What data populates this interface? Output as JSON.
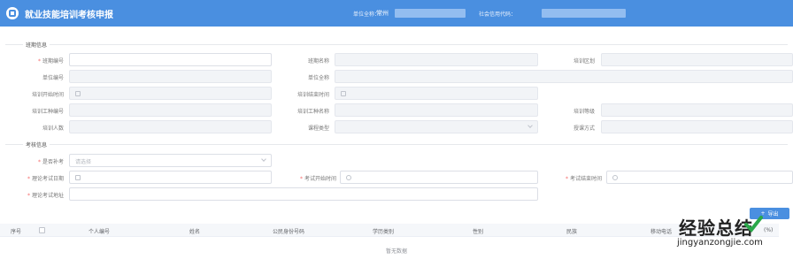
{
  "header": {
    "title": "就业技能培训考核申报",
    "unit_label": "单位全称：",
    "unit_value": "常州",
    "credit_label": "社会信用代码："
  },
  "sections": {
    "class_info": "班期信息",
    "exam_info": "考核信息"
  },
  "class_form": {
    "class_no": {
      "label": "班期编号"
    },
    "class_name": {
      "label": "班期名称"
    },
    "training_district": {
      "label": "培训区划"
    },
    "unit_no": {
      "label": "单位编号"
    },
    "unit_full_name": {
      "label": "单位全称"
    },
    "training_start": {
      "label": "培训开始时间"
    },
    "training_end": {
      "label": "培训结束时间"
    },
    "job_type_no": {
      "label": "培训工种编号"
    },
    "job_type_name": {
      "label": "培训工种名称"
    },
    "training_level": {
      "label": "培训等级"
    },
    "trainee_count": {
      "label": "培训人数"
    },
    "course_type": {
      "label": "课程类型"
    },
    "teaching_mode": {
      "label": "授课方式"
    }
  },
  "exam_form": {
    "is_makeup": {
      "label": "是否补考",
      "placeholder": "请选择"
    },
    "theory_exam_date": {
      "label": "理论考试日期"
    },
    "exam_start_time": {
      "label": "考试开始时间"
    },
    "exam_end_time": {
      "label": "考试结束时间"
    },
    "theory_exam_address": {
      "label": "理论考试地址"
    }
  },
  "actions": {
    "export": "导出"
  },
  "table": {
    "columns": [
      "序号",
      "个人编号",
      "姓名",
      "公民身份号码",
      "学历类别",
      "性别",
      "民族",
      "移动电话"
    ],
    "empty_text": "暂无数据",
    "partial_col": "(%)"
  },
  "watermark": {
    "cn": "经验总结",
    "url": "jingyanzongjie.com"
  },
  "colors": {
    "header_bg": "#4a8fe0",
    "required": "#f56c6c",
    "disabled_bg": "#f2f4f7"
  }
}
